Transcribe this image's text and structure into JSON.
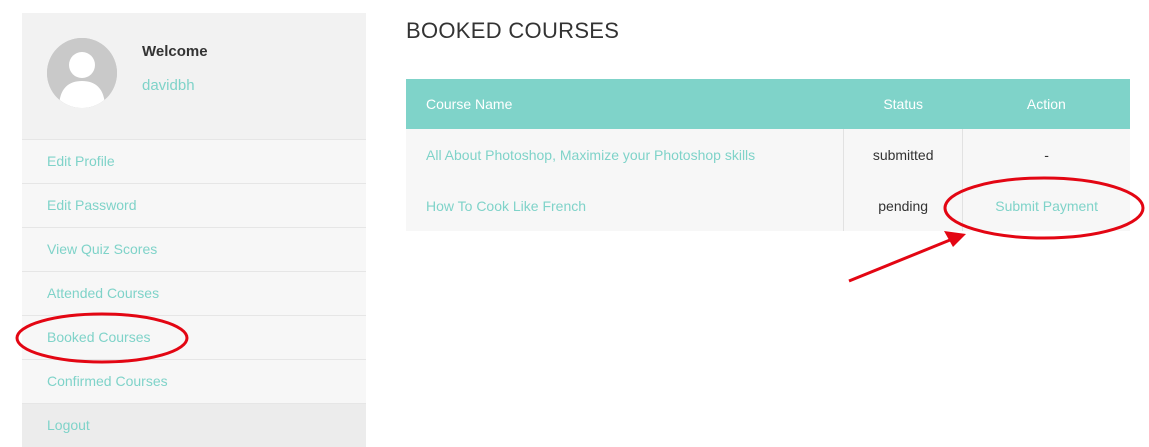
{
  "sidebar": {
    "welcome": "Welcome",
    "username": "davidbh",
    "items": [
      {
        "label": "Edit Profile"
      },
      {
        "label": "Edit Password"
      },
      {
        "label": "View Quiz Scores"
      },
      {
        "label": "Attended Courses"
      },
      {
        "label": "Booked Courses"
      },
      {
        "label": "Confirmed Courses"
      },
      {
        "label": "Logout"
      }
    ]
  },
  "main": {
    "title": "BOOKED COURSES",
    "table": {
      "headers": {
        "name": "Course Name",
        "status": "Status",
        "action": "Action"
      },
      "rows": [
        {
          "name": "All About Photoshop, Maximize your Photoshop skills",
          "status": "submitted",
          "action": "-"
        },
        {
          "name": "How To Cook Like French",
          "status": "pending",
          "action": "Submit Payment"
        }
      ]
    }
  },
  "colors": {
    "accent": "#7fd3c9",
    "annotation": "#e30613"
  }
}
